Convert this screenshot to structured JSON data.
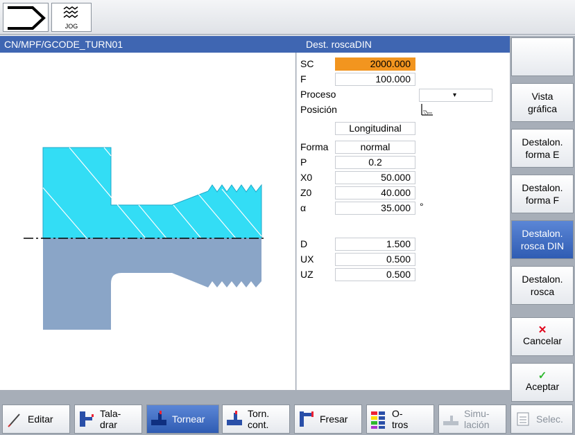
{
  "topbar": {
    "mode_icon": "arrow-mode-icon",
    "jog_label": "JOG"
  },
  "header": {
    "path": "CN/MPF/GCODE_TURN01",
    "cycle": "Dest. roscaDIN"
  },
  "params": {
    "sc_label": "SC",
    "sc_value": "2000.000",
    "f_label": "F",
    "f_value": "100.000",
    "proceso_label": "Proceso",
    "posicion_label": "Posición",
    "direction_value": "Longitudinal",
    "forma_label": "Forma",
    "forma_value": "normal",
    "p_label": "P",
    "p_value": "0.2",
    "x0_label": "X0",
    "x0_value": "50.000",
    "z0_label": "Z0",
    "z0_value": "40.000",
    "alpha_label": "α",
    "alpha_value": "35.000",
    "alpha_unit": "°",
    "d_label": "D",
    "d_value": "1.500",
    "ux_label": "UX",
    "ux_value": "0.500",
    "uz_label": "UZ",
    "uz_value": "0.500"
  },
  "right_softkeys": [
    {
      "line1": "",
      "line2": ""
    },
    {
      "line1": "Vista",
      "line2": "gráfica"
    },
    {
      "line1": "Destalon.",
      "line2": "forma E"
    },
    {
      "line1": "Destalon.",
      "line2": "forma F"
    },
    {
      "line1": "Destalon.",
      "line2": "rosca DIN"
    },
    {
      "line1": "Destalon.",
      "line2": "rosca"
    },
    {
      "line1": "Cancelar",
      "line2": ""
    },
    {
      "line1": "Aceptar",
      "line2": ""
    }
  ],
  "bottom_softkeys": [
    {
      "line1": "Editar",
      "line2": ""
    },
    {
      "line1": "Tala-",
      "line2": "drar"
    },
    {
      "line1": "Tornear",
      "line2": ""
    },
    {
      "line1": "Torn.",
      "line2": "cont."
    },
    {
      "line1": "Fresar",
      "line2": ""
    },
    {
      "line1": "O-",
      "line2": "tros"
    },
    {
      "line1": "Simu-",
      "line2": "lación"
    },
    {
      "line1": "Selec.",
      "line2": ""
    }
  ],
  "colors": {
    "header": "#3f66b2",
    "active_field": "#f2951f",
    "part_top": "#33ddf5",
    "part_bottom": "#8aa5c7",
    "selected_key": "#3f66b2"
  }
}
